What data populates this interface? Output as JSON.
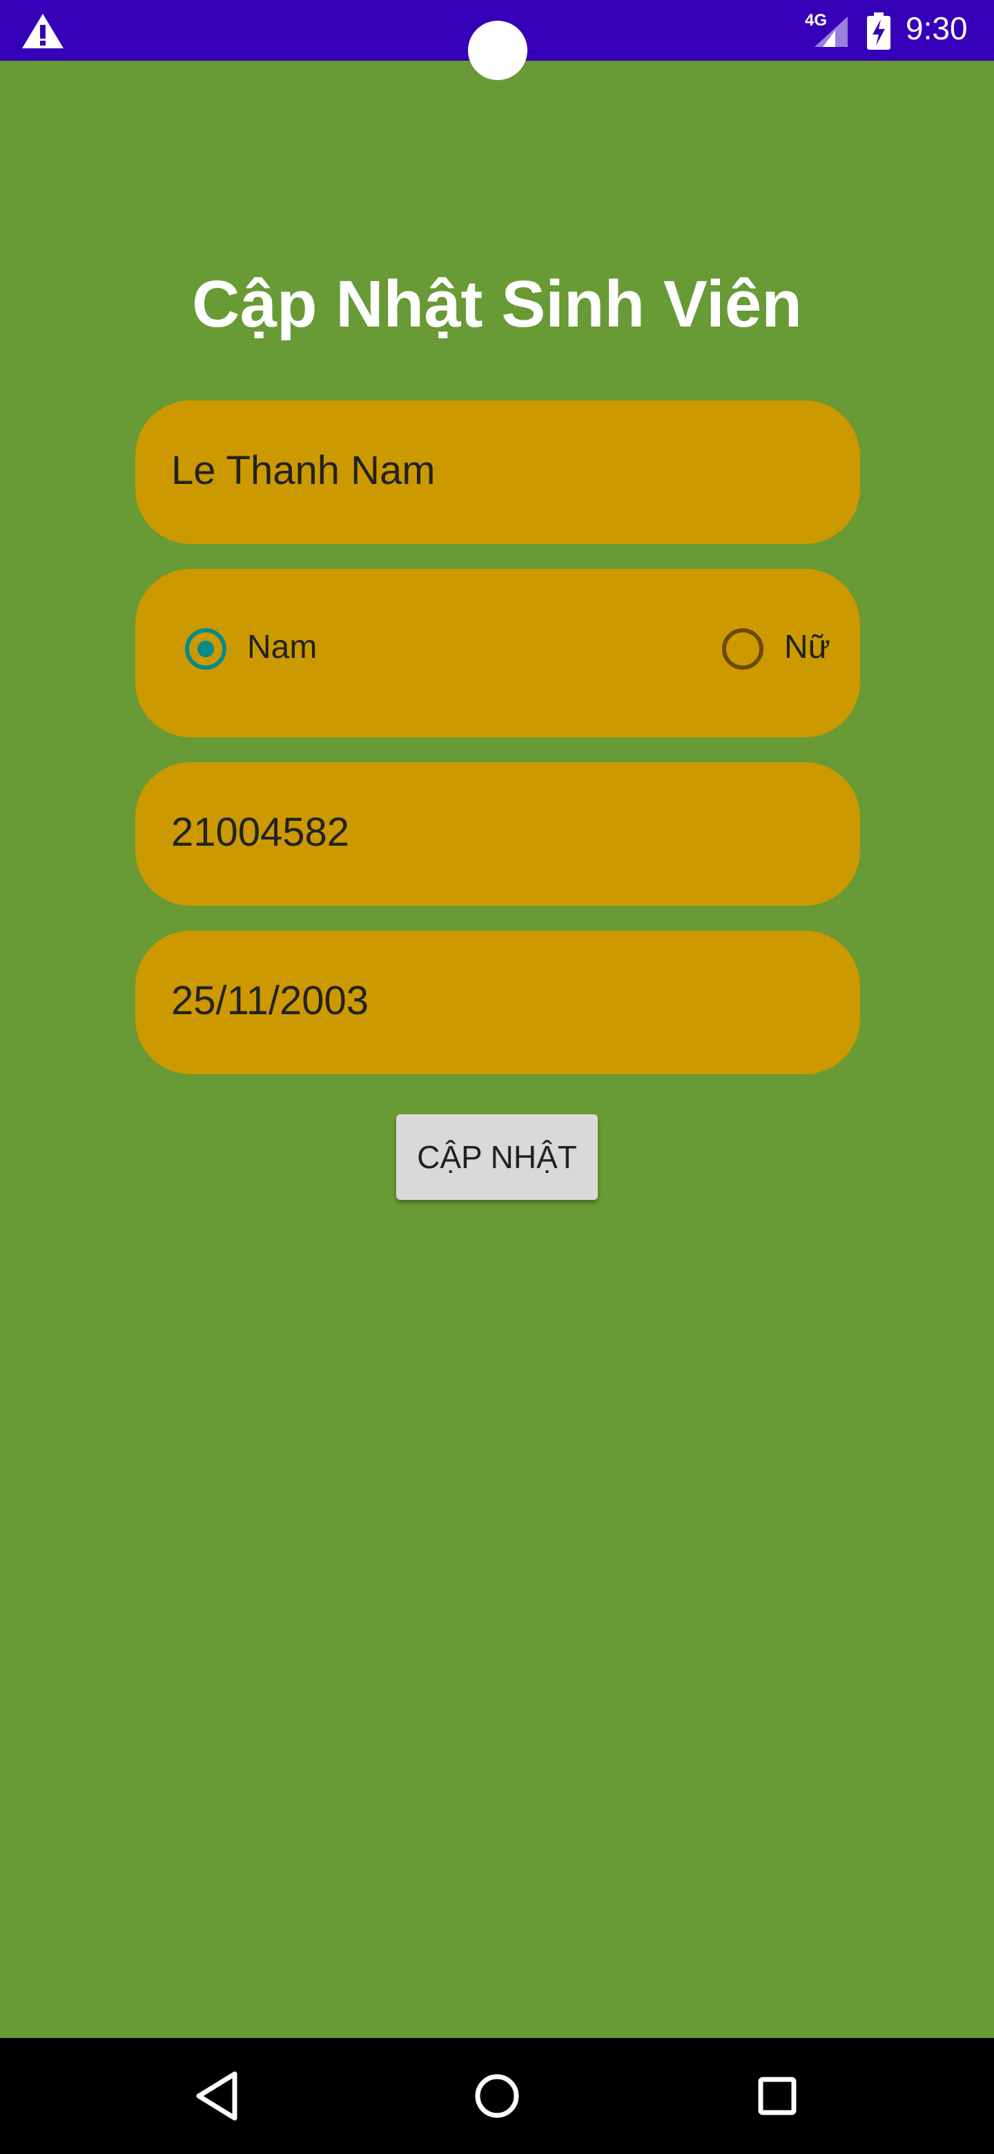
{
  "status_bar": {
    "network": "4G",
    "time": "9:30",
    "icons": [
      "warning-icon",
      "signal-icon",
      "battery-charging-icon"
    ],
    "background": "#3600b8"
  },
  "form": {
    "title": "Cập Nhật Sinh Viên",
    "name_value": "Le Thanh Nam",
    "gender": {
      "options": [
        {
          "label": "Nam",
          "checked": true
        },
        {
          "label": "Nữ",
          "checked": false
        }
      ]
    },
    "student_id_value": "21004582",
    "dob_value": "25/11/2003",
    "update_label": "CẬP NHẬT"
  },
  "nav_bar": {
    "icons": [
      "back-icon",
      "home-icon",
      "recents-icon"
    ]
  },
  "colors": {
    "background": "#689a35",
    "field": "#cc9900",
    "accent": "#078a8a"
  }
}
